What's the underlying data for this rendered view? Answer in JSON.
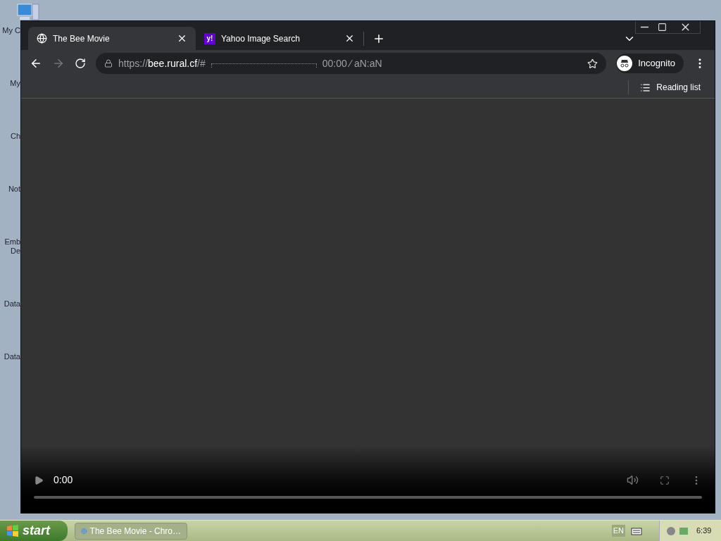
{
  "desktop_icons": [
    {
      "lines": [
        "My C"
      ]
    },
    {
      "lines": [
        "My"
      ]
    },
    {
      "lines": [
        "Ch"
      ]
    },
    {
      "lines": [
        "Not"
      ]
    },
    {
      "lines": [
        "Emb",
        "De"
      ]
    },
    {
      "lines": [
        "Data"
      ]
    },
    {
      "lines": [
        "Data"
      ]
    }
  ],
  "browser": {
    "tabs": [
      {
        "title": "The Bee Movie",
        "selected": true,
        "kind": "globe"
      },
      {
        "title": "Yahoo Image Search",
        "selected": false,
        "kind": "logo",
        "favicon_text": "y!"
      }
    ],
    "address": {
      "scheme": "https://",
      "host": "bee.rural.cf",
      "path": "/#",
      "tail": "00:00 ⁄ aN:aN"
    },
    "profile": "Incognito",
    "reading_list": "Reading list",
    "video": {
      "time": "0:00",
      "level": 0
    }
  },
  "taskbar": {
    "start": "start",
    "tasks": [
      {
        "title": "The Bee Movie - Chro…",
        "selected": false
      }
    ],
    "language": "EN",
    "clock": "6:39"
  }
}
